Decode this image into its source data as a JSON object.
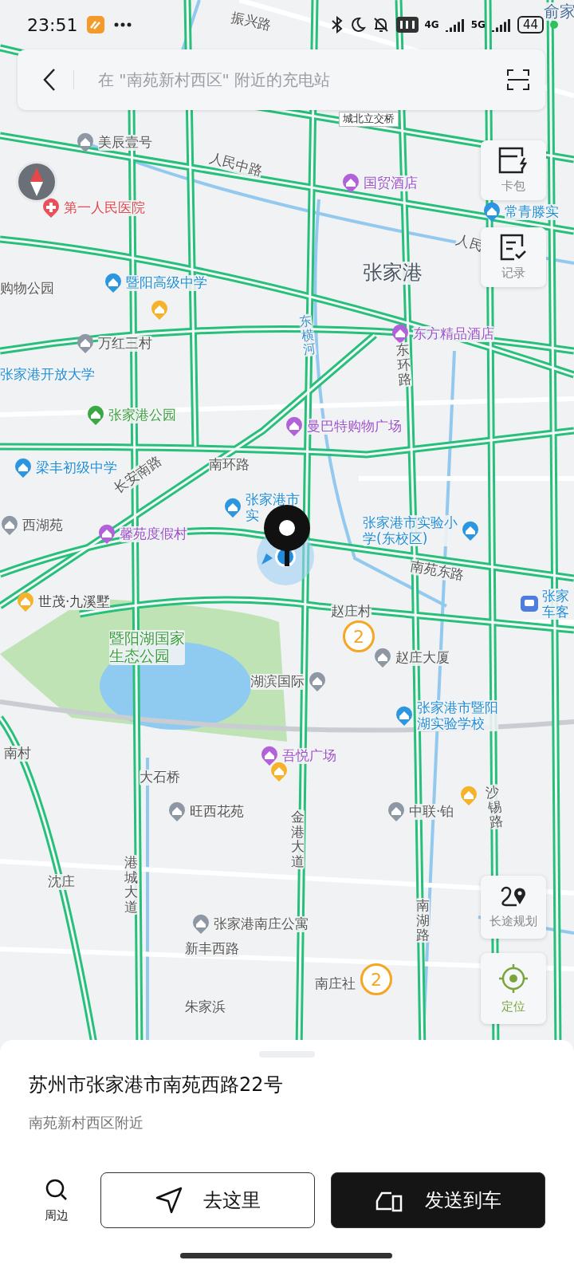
{
  "status_bar": {
    "time": "23:51",
    "network_1": "4G",
    "network_2": "5G",
    "battery": "44"
  },
  "search": {
    "placeholder": "在 \"南苑新村西区\" 附近的充电站"
  },
  "map": {
    "labels": [
      {
        "kind": "road",
        "lines": [
          "振兴路"
        ]
      },
      {
        "kind": "town",
        "lines": [
          "俞家"
        ]
      },
      {
        "kind": "bridge",
        "lines": [
          "城北立交桥"
        ]
      },
      {
        "kind": "poi-home",
        "lines": [
          "美辰壹号"
        ]
      },
      {
        "kind": "road",
        "lines": [
          "人民中路"
        ]
      },
      {
        "kind": "poi-hotel",
        "lines": [
          "国贸酒店"
        ]
      },
      {
        "kind": "poi-hospital",
        "lines": [
          "第一人民医院"
        ]
      },
      {
        "kind": "poi-edu",
        "lines": [
          "常青滕实"
        ]
      },
      {
        "kind": "road",
        "lines": [
          "人民"
        ]
      },
      {
        "kind": "plain",
        "lines": [
          "购物公园"
        ]
      },
      {
        "kind": "poi-edu",
        "lines": [
          "暨阳高级中学"
        ]
      },
      {
        "kind": "district",
        "lines": [
          "张家港"
        ]
      },
      {
        "kind": "poi-home",
        "lines": [
          "万红三村"
        ]
      },
      {
        "kind": "poi-hotel",
        "lines": [
          "东方精品酒店"
        ]
      },
      {
        "kind": "water",
        "lines": [
          "东横河"
        ]
      },
      {
        "kind": "road-v",
        "lines": [
          "东环路"
        ]
      },
      {
        "kind": "edu-text",
        "lines": [
          "张家港开放大学"
        ]
      },
      {
        "kind": "poi-park",
        "lines": [
          "张家港公园"
        ]
      },
      {
        "kind": "poi-shop",
        "lines": [
          "曼巴特购物广场"
        ]
      },
      {
        "kind": "poi-edu",
        "lines": [
          "梁丰初级中学"
        ]
      },
      {
        "kind": "road",
        "lines": [
          "长安南路"
        ]
      },
      {
        "kind": "road",
        "lines": [
          "南环路"
        ]
      },
      {
        "kind": "poi-edu",
        "lines": [
          "张家港市",
          "实"
        ]
      },
      {
        "kind": "poi-home",
        "lines": [
          "西湖苑"
        ]
      },
      {
        "kind": "poi-hotel",
        "lines": [
          "馨苑度假村"
        ]
      },
      {
        "kind": "poi-edu-right",
        "lines": [
          "张家港市实验小",
          "学(东校区)"
        ]
      },
      {
        "kind": "road",
        "lines": [
          "南苑东路"
        ]
      },
      {
        "kind": "poi-estate",
        "lines": [
          "世茂·九溪墅"
        ]
      },
      {
        "kind": "plain",
        "lines": [
          "赵庄村"
        ]
      },
      {
        "kind": "poi-bus",
        "lines": [
          "张家",
          "车客"
        ]
      },
      {
        "kind": "park-text",
        "lines": [
          "暨阳湖国家",
          "生态公园"
        ]
      },
      {
        "kind": "poi-home",
        "lines": [
          "赵庄大厦"
        ]
      },
      {
        "kind": "poi-home-right",
        "lines": [
          "湖滨国际"
        ]
      },
      {
        "kind": "poi-edu",
        "lines": [
          "张家港市暨阳",
          "湖实验学校"
        ]
      },
      {
        "kind": "plain",
        "lines": [
          "南村"
        ]
      },
      {
        "kind": "poi-shop",
        "lines": [
          "吾悦广场"
        ]
      },
      {
        "kind": "plain",
        "lines": [
          "大石桥"
        ]
      },
      {
        "kind": "poi-home",
        "lines": [
          "旺西花苑"
        ]
      },
      {
        "kind": "road-v",
        "lines": [
          "金港大道"
        ]
      },
      {
        "kind": "poi-home",
        "lines": [
          "中联·铂"
        ]
      },
      {
        "kind": "road-v",
        "lines": [
          "沙锡路"
        ]
      },
      {
        "kind": "road-v",
        "lines": [
          "港城大道"
        ]
      },
      {
        "kind": "plain",
        "lines": [
          "沈庄"
        ]
      },
      {
        "kind": "poi-home",
        "lines": [
          "张家港南庄公寓"
        ]
      },
      {
        "kind": "road-v",
        "lines": [
          "南湖路"
        ]
      },
      {
        "kind": "road",
        "lines": [
          "新丰西路"
        ]
      },
      {
        "kind": "plain",
        "lines": [
          "南庄社"
        ]
      },
      {
        "kind": "plain",
        "lines": [
          "朱家浜"
        ]
      }
    ],
    "clusters": [
      {
        "count": "2"
      },
      {
        "count": "2"
      }
    ]
  },
  "side_tools": [
    {
      "label": "卡包"
    },
    {
      "label": "记录"
    }
  ],
  "bottom_tools": [
    {
      "label": "长途规划",
      "selected": false
    },
    {
      "label": "定位",
      "selected": true
    }
  ],
  "place": {
    "title": "苏州市张家港市南苑西路22号",
    "subtitle": "南苑新村西区附近"
  },
  "actions": {
    "nearby": "周边",
    "go": "去这里",
    "send": "发送到车"
  }
}
